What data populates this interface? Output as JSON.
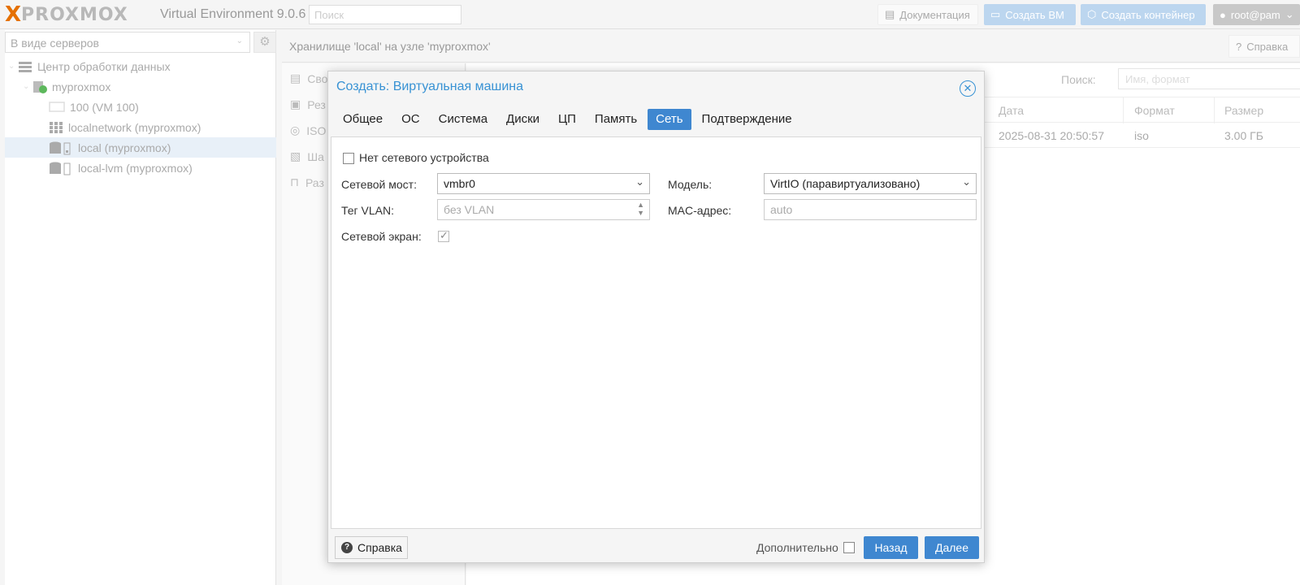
{
  "topbar": {
    "logo_text": "PROXMOX",
    "version_title": "Virtual Environment 9.0.6",
    "search_placeholder": "Поиск",
    "doc_label": "Документация",
    "create_vm_label": "Создать ВМ",
    "create_ct_label": "Создать контейнер",
    "user_label": "root@pam"
  },
  "sidebar": {
    "view_select": "В виде серверов",
    "tree": [
      {
        "label": "Центр обработки данных",
        "level": 0
      },
      {
        "label": "myproxmox",
        "level": 1
      },
      {
        "label": "100 (VM 100)",
        "level": 2
      },
      {
        "label": "localnetwork (myproxmox)",
        "level": 2
      },
      {
        "label": "local (myproxmox)",
        "level": 2,
        "selected": true
      },
      {
        "label": "local-lvm (myproxmox)",
        "level": 2
      }
    ]
  },
  "content": {
    "title": "Хранилище 'local' на узле 'myproxmox'",
    "help_label": "Справка",
    "subnav": [
      "Сво",
      "Рез",
      "ISO",
      "Ша",
      "Раз"
    ],
    "search_label": "Поиск:",
    "search_placeholder": "Имя, формат",
    "columns": [
      "Дата",
      "Формат",
      "Размер"
    ],
    "rows": [
      {
        "date": "2025-08-31 20:50:57",
        "format": "iso",
        "size": "3.00 ГБ"
      }
    ]
  },
  "dialog": {
    "title": "Создать: Виртуальная машина",
    "tabs": [
      "Общее",
      "ОС",
      "Система",
      "Диски",
      "ЦП",
      "Память",
      "Сеть",
      "Подтверждение"
    ],
    "active_tab": "Сеть",
    "no_network_label": "Нет сетевого устройства",
    "bridge_label": "Сетевой мост:",
    "bridge_value": "vmbr0",
    "vlan_label": "Тег VLAN:",
    "vlan_placeholder": "без VLAN",
    "firewall_label": "Сетевой экран:",
    "firewall_checked": true,
    "model_label": "Модель:",
    "model_value": "VirtIO (паравиртуализовано)",
    "mac_label": "MAC-адрес:",
    "mac_placeholder": "auto",
    "help_label": "Справка",
    "advanced_label": "Дополнительно",
    "back_label": "Назад",
    "next_label": "Далее"
  },
  "colors": {
    "accent": "#3f87d0",
    "title_blue": "#3892d4",
    "logo_orange": "#e57000"
  }
}
